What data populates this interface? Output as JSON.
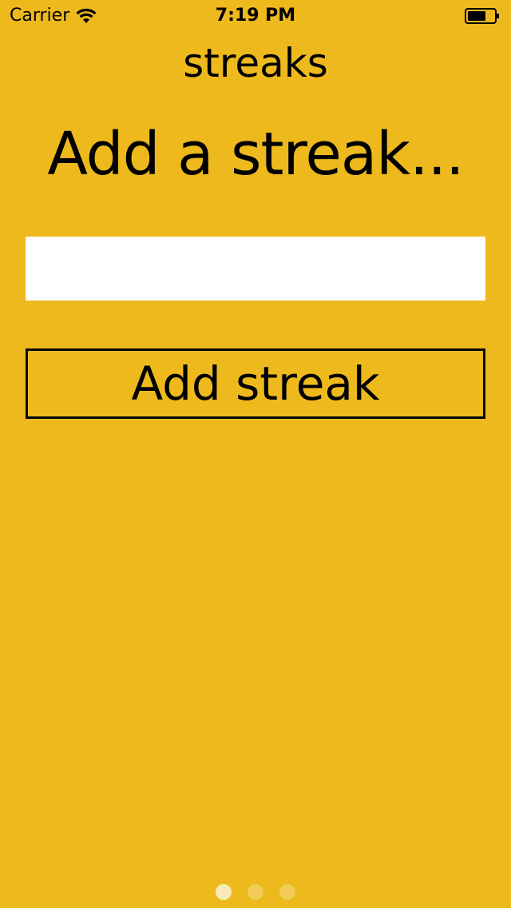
{
  "status_bar": {
    "carrier": "Carrier",
    "time": "7:19 PM",
    "wifi_icon": "wifi-icon",
    "battery_icon": "battery-icon"
  },
  "app": {
    "title": "streaks"
  },
  "main": {
    "heading": "Add a streak...",
    "input": {
      "value": "",
      "placeholder": ""
    },
    "add_button_label": "Add streak"
  },
  "page_control": {
    "pages": 3,
    "current_page": 1
  },
  "colors": {
    "background": "#EEB91C",
    "text": "#000000",
    "input_background": "#FFFFFF"
  }
}
